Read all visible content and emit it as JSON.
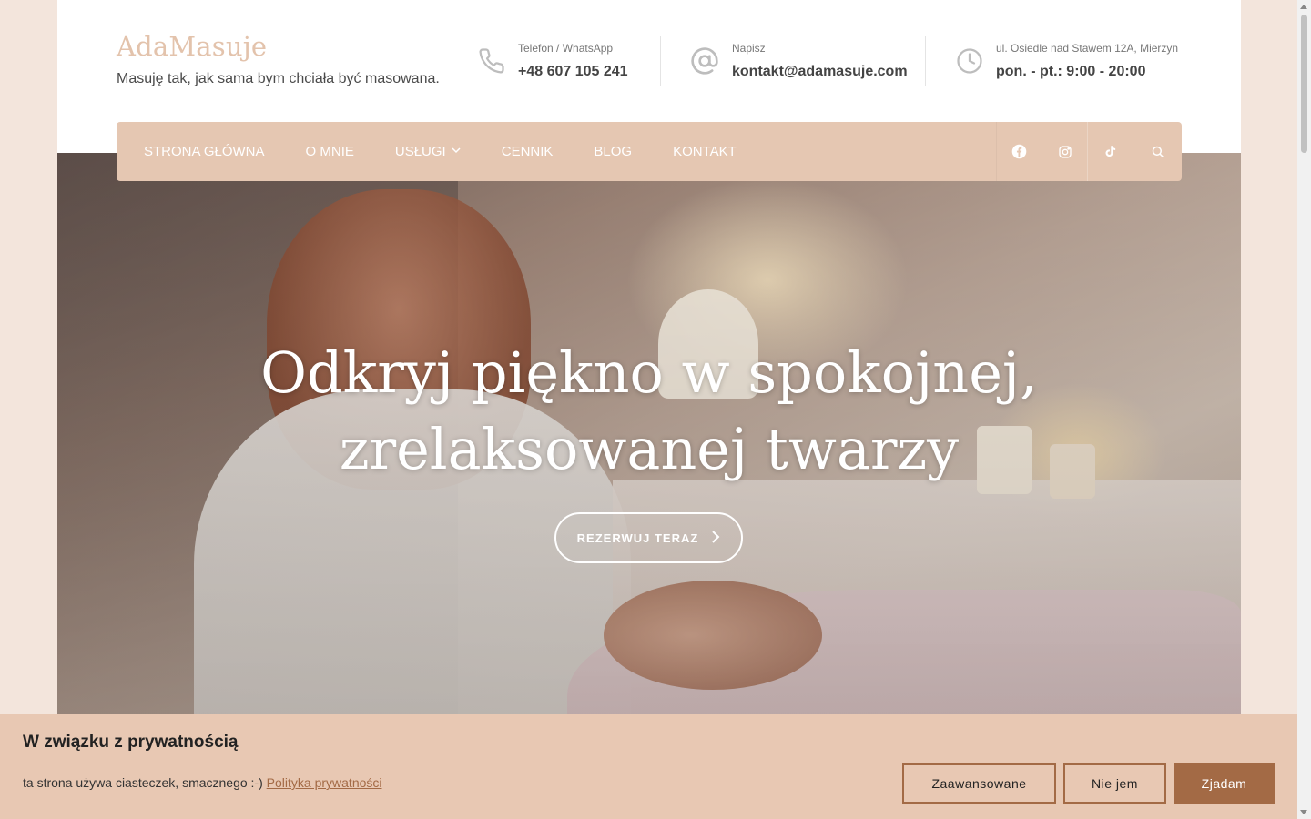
{
  "brand": {
    "name": "AdaMasuje",
    "tagline": "Masuję tak, jak sama bym chciała być masowana."
  },
  "contacts": [
    {
      "icon": "phone-icon",
      "label": "Telefon / WhatsApp",
      "value": "+48 607 105 241"
    },
    {
      "icon": "at-icon",
      "label": "Napisz",
      "value": "kontakt@adamasuje.com"
    },
    {
      "icon": "clock-icon",
      "label": "ul. Osiedle nad Stawem 12A, Mierzyn",
      "value": "pon. - pt.: 9:00 - 20:00"
    }
  ],
  "nav": {
    "items": [
      {
        "label": "STRONA GŁÓWNA"
      },
      {
        "label": "O MNIE"
      },
      {
        "label": "USŁUGI",
        "has_dropdown": true
      },
      {
        "label": "CENNIK"
      },
      {
        "label": "BLOG"
      },
      {
        "label": "KONTAKT"
      }
    ],
    "icons": [
      "facebook-icon",
      "instagram-icon",
      "tiktok-icon",
      "search-icon"
    ]
  },
  "hero": {
    "title_line1": "Odkryj piękno w spokojnej,",
    "title_line2": "zrelaksowanej twarzy",
    "cta": "REZERWUJ TERAZ"
  },
  "cookie": {
    "title": "W związku z prywatnością",
    "text": "ta strona używa ciasteczek, smacznego :-)",
    "link": "Polityka prywatności",
    "buttons": {
      "advanced": "Zaawansowane",
      "decline": "Nie jem",
      "accept": "Zjadam"
    }
  },
  "colors": {
    "accent": "#e5c7b2",
    "brand": "#e3c3ac",
    "button": "#a36a45",
    "page_bg": "#f3e5dc"
  }
}
